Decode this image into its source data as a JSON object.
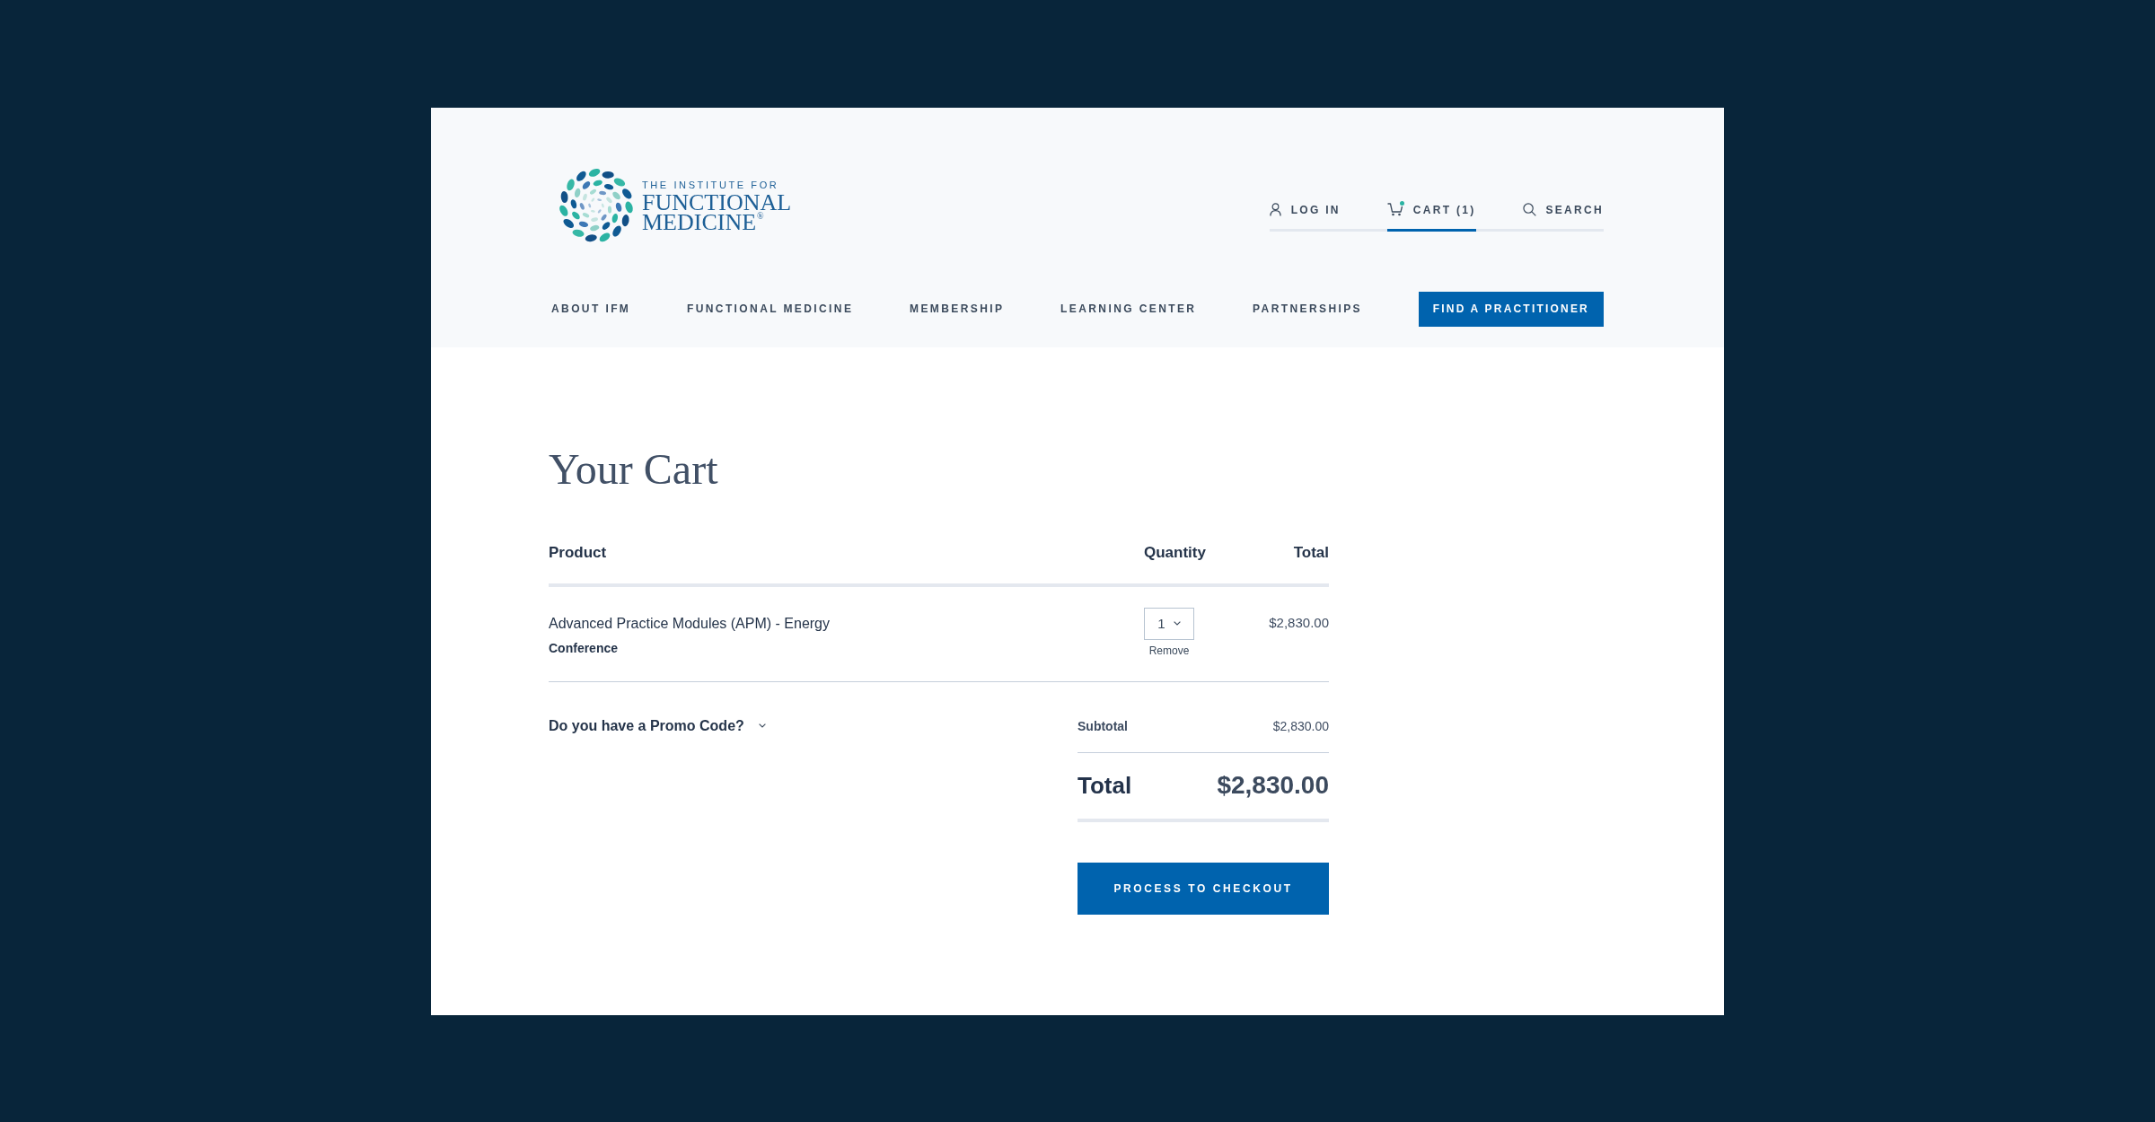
{
  "header": {
    "logo": {
      "tagline": "THE INSTITUTE FOR",
      "name_line_1": "FUNCTIONAL",
      "name_line_2": "MEDICINE$^{®}$"
    },
    "utility_nav": [
      {
        "kind": "login",
        "label": "LOG IN",
        "selected": false
      },
      {
        "kind": "cart",
        "label": "CART (1)",
        "selected": true,
        "notification": true
      },
      {
        "kind": "search",
        "label": "SEARCH",
        "selected": false
      }
    ],
    "main_nav": {
      "items": [
        "ABOUT IFM",
        "FUNCTIONAL MEDICINE",
        "MEMBERSHIP",
        "LEARNING CENTER",
        "PARTNERSHIPS"
      ],
      "cta": "FIND A PRACTITIONER"
    }
  },
  "cart": {
    "title": "Your Cart",
    "columns": [
      "Product",
      "Quantity",
      "Total"
    ],
    "items": [
      {
        "name": "Advanced Practice Modules (APM) - Energy",
        "category": "Conference",
        "quantity": "1",
        "remove_label": "Remove",
        "total": "$2,830.00"
      }
    ]
  },
  "promo": {
    "label": "Do you have a Promo Code?",
    "expanded": false
  },
  "summary": {
    "subtotal_label": "Subtotal",
    "subtotal": "$2,830.00",
    "total_label": "Total",
    "total": "$2,830.00"
  },
  "checkout_button": "PROCESS TO CHECKOUT"
}
